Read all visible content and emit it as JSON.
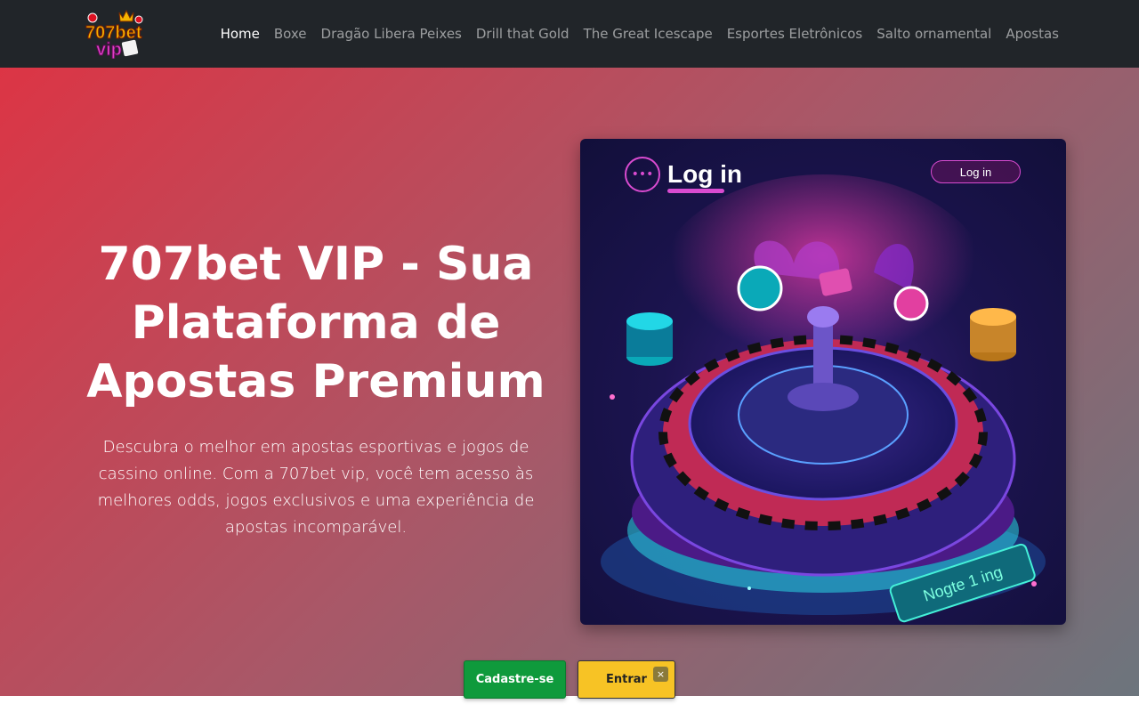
{
  "brand": {
    "logo_text_top": "707bet",
    "logo_text_bottom": "vip"
  },
  "nav": {
    "items": [
      {
        "label": "Home",
        "active": true
      },
      {
        "label": "Boxe",
        "active": false
      },
      {
        "label": "Dragão Libera Peixes",
        "active": false
      },
      {
        "label": "Drill that Gold",
        "active": false
      },
      {
        "label": "The Great Icescape",
        "active": false
      },
      {
        "label": "Esportes Eletrônicos",
        "active": false
      },
      {
        "label": "Salto ornamental",
        "active": false
      },
      {
        "label": "Apostas",
        "active": false
      }
    ]
  },
  "hero": {
    "title": "707bet VIP - Sua Plataforma de Apostas Premium",
    "description": "Descubra o melhor em apostas esportivas e jogos de cassino online. Com a 707bet vip, você tem acesso às melhores odds, jogos exclusivos e uma experiência de apostas incomparável.",
    "image": {
      "title": "Log in",
      "login_button": "Log in",
      "table_text": "Nogte 1 ing"
    }
  },
  "cta": {
    "signup_label": "Cadastre-se",
    "login_label": "Entrar",
    "close_label": "×"
  },
  "colors": {
    "navbar_bg": "#212529",
    "hero_gradient_start": "#dc3545",
    "hero_gradient_end": "#6c757d",
    "signup_green": "#0f9a3c",
    "login_yellow": "#f7c325",
    "accent_magenta": "#d94bd0"
  }
}
